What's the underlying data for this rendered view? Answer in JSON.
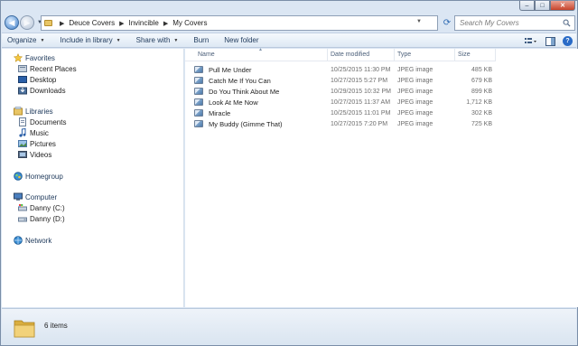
{
  "caption": {
    "minimize": "–",
    "maximize": "□",
    "close": "✕"
  },
  "address": {
    "crumbs": [
      "Deuce Covers",
      "Invincible",
      "My Covers"
    ],
    "search_placeholder": "Search My Covers"
  },
  "toolbar": {
    "organize": "Organize",
    "include_in_library": "Include in library",
    "share_with": "Share with",
    "burn": "Burn",
    "new_folder": "New folder"
  },
  "nav": {
    "favorites": "Favorites",
    "recent_places": "Recent Places",
    "desktop": "Desktop",
    "downloads": "Downloads",
    "libraries": "Libraries",
    "documents": "Documents",
    "music": "Music",
    "pictures": "Pictures",
    "videos": "Videos",
    "homegroup": "Homegroup",
    "computer": "Computer",
    "drive_c": "Danny (C:)",
    "drive_d": "Danny (D:)",
    "network": "Network"
  },
  "columns": {
    "name": "Name",
    "date": "Date modified",
    "type": "Type",
    "size": "Size"
  },
  "files": [
    {
      "name": "Pull Me Under",
      "date": "10/25/2015 11:30 PM",
      "type": "JPEG image",
      "size": "485 KB"
    },
    {
      "name": "Catch Me If You Can",
      "date": "10/27/2015 5:27 PM",
      "type": "JPEG image",
      "size": "679 KB"
    },
    {
      "name": "Do You Think About Me",
      "date": "10/29/2015 10:32 PM",
      "type": "JPEG image",
      "size": "899 KB"
    },
    {
      "name": "Look At Me Now",
      "date": "10/27/2015 11:37 AM",
      "type": "JPEG image",
      "size": "1,712 KB"
    },
    {
      "name": "Miracle",
      "date": "10/25/2015 11:01 PM",
      "type": "JPEG image",
      "size": "302 KB"
    },
    {
      "name": "My Buddy (Gimme That)",
      "date": "10/27/2015 7:20 PM",
      "type": "JPEG image",
      "size": "725 KB"
    }
  ],
  "status": {
    "item_count": "6 items"
  },
  "colors": {
    "folder": "#e8c565",
    "accent": "#2a6bc7",
    "frame": "#dbe6f3"
  }
}
